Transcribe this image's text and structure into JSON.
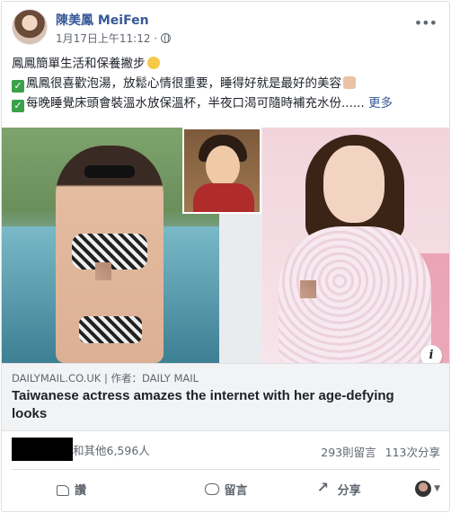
{
  "post": {
    "author": "陳美鳳 MeiFen",
    "timestamp": "1月17日上午11:12 ·",
    "privacy_icon": "globe-icon",
    "text_lines": [
      "鳳鳳簡單生活和保養撇步",
      "鳳鳳很喜歡泡湯，放鬆心情很重要，睡得好就是最好的美容",
      "每晚睡覺床頭會裝溫水放保溫杯，半夜口渴可隨時補充水份......"
    ],
    "see_more": "更多"
  },
  "link": {
    "source": "DAILYMAIL.CO.UK | 作者：DAILY MAIL",
    "title": "Taiwanese actress amazes the internet with her age-defying looks",
    "info_label": "i"
  },
  "stats": {
    "reactions": "和其他6,596人",
    "comments": "293則留言",
    "shares": "113次分享"
  },
  "actions": {
    "like": "讚",
    "comment": "留言",
    "share": "分享"
  },
  "colors": {
    "link_blue": "#385898",
    "secondary_text": "#606770",
    "check_green": "#3aa14a"
  }
}
